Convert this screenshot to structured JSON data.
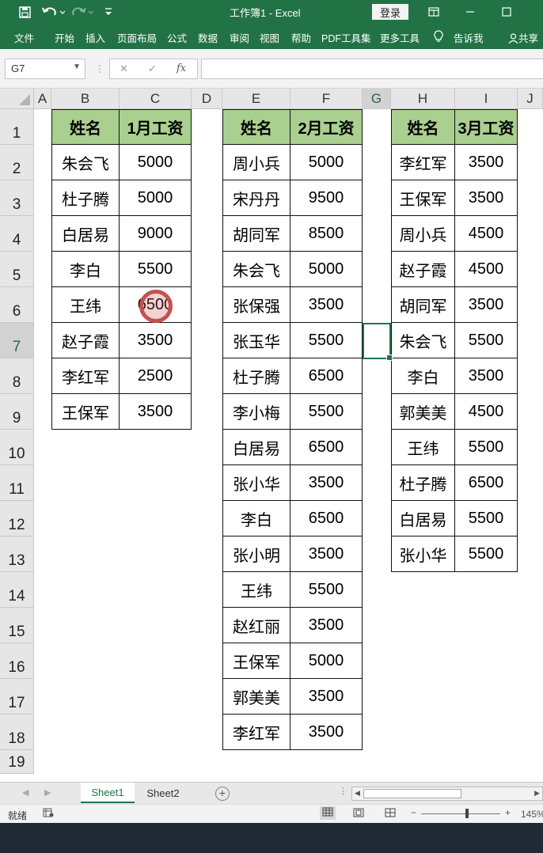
{
  "titlebar": {
    "save_icon": "save-icon",
    "undo_icon": "undo-icon",
    "redo_icon": "redo-icon",
    "doc_title": "工作簿1  -  Excel",
    "login": "登录",
    "layout_icon": "ribbon-display-icon",
    "minimize_icon": "minimize-icon",
    "maximize_icon": "maximize-icon"
  },
  "ribbon": {
    "tabs": [
      "文件",
      "开始",
      "插入",
      "页面布局",
      "公式",
      "数据",
      "审阅",
      "视图",
      "帮助",
      "PDF工具集",
      "更多工具",
      "告诉我"
    ],
    "share": "共享"
  },
  "formula_bar": {
    "cell_ref": "G7",
    "cancel_glyph": "✕",
    "enter_glyph": "✓",
    "fx": "fx",
    "formula": ""
  },
  "columns": [
    "A",
    "B",
    "C",
    "D",
    "E",
    "F",
    "G",
    "H",
    "I",
    "J"
  ],
  "rows": [
    "1",
    "2",
    "3",
    "4",
    "5",
    "6",
    "7",
    "8",
    "9",
    "10",
    "11",
    "12",
    "13",
    "14",
    "15",
    "16",
    "17",
    "18",
    "19"
  ],
  "tables": {
    "jan": {
      "name_header": "姓名",
      "value_header": "1月工资",
      "rows": [
        [
          "朱会飞",
          "5000"
        ],
        [
          "杜子腾",
          "5000"
        ],
        [
          "白居易",
          "9000"
        ],
        [
          "李白",
          "5500"
        ],
        [
          "王纬",
          "6500"
        ],
        [
          "赵子霞",
          "3500"
        ],
        [
          "李红军",
          "2500"
        ],
        [
          "王保军",
          "3500"
        ]
      ]
    },
    "feb": {
      "name_header": "姓名",
      "value_header": "2月工资",
      "rows": [
        [
          "周小兵",
          "5000"
        ],
        [
          "宋丹丹",
          "9500"
        ],
        [
          "胡同军",
          "8500"
        ],
        [
          "朱会飞",
          "5000"
        ],
        [
          "张保强",
          "3500"
        ],
        [
          "张玉华",
          "5500"
        ],
        [
          "杜子腾",
          "6500"
        ],
        [
          "李小梅",
          "5500"
        ],
        [
          "白居易",
          "6500"
        ],
        [
          "张小华",
          "3500"
        ],
        [
          "李白",
          "6500"
        ],
        [
          "张小明",
          "3500"
        ],
        [
          "王纬",
          "5500"
        ],
        [
          "赵红丽",
          "3500"
        ],
        [
          "王保军",
          "5000"
        ],
        [
          "郭美美",
          "3500"
        ],
        [
          "李红军",
          "3500"
        ]
      ]
    },
    "mar": {
      "name_header": "姓名",
      "value_header": "3月工资",
      "rows": [
        [
          "李红军",
          "3500"
        ],
        [
          "王保军",
          "3500"
        ],
        [
          "周小兵",
          "4500"
        ],
        [
          "赵子霞",
          "4500"
        ],
        [
          "胡同军",
          "3500"
        ],
        [
          "朱会飞",
          "5500"
        ],
        [
          "李白",
          "3500"
        ],
        [
          "郭美美",
          "4500"
        ],
        [
          "王纬",
          "5500"
        ],
        [
          "杜子腾",
          "6500"
        ],
        [
          "白居易",
          "5500"
        ],
        [
          "张小华",
          "5500"
        ]
      ]
    }
  },
  "sheets": [
    "Sheet1",
    "Sheet2"
  ],
  "status": {
    "ready": "就绪",
    "zoom_level": "145%",
    "minus": "−",
    "plus": "+"
  }
}
